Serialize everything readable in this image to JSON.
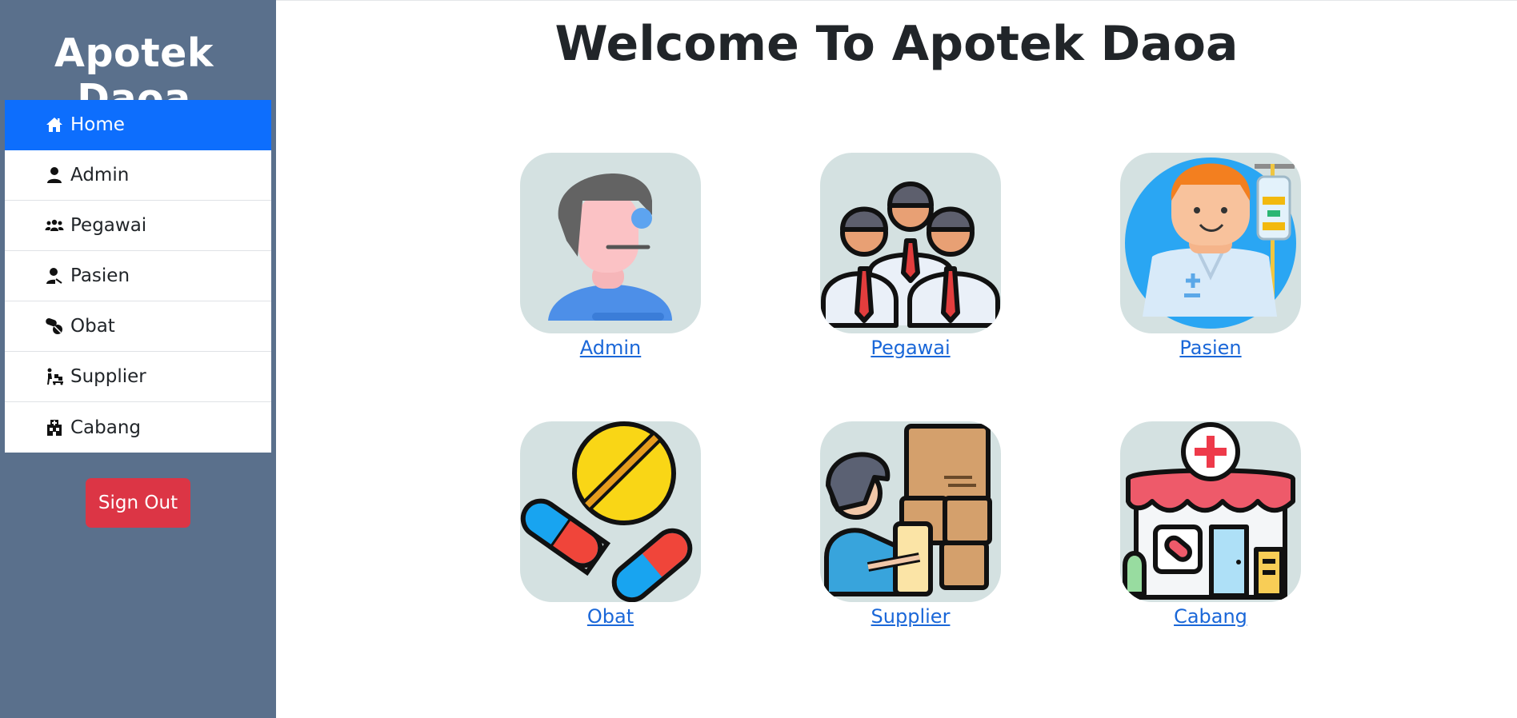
{
  "sidebar": {
    "brand": "Apotek Daoa",
    "items": [
      {
        "label": "Home",
        "icon": "home-icon",
        "active": true
      },
      {
        "label": "Admin",
        "icon": "user-icon",
        "active": false
      },
      {
        "label": "Pegawai",
        "icon": "users-icon",
        "active": false
      },
      {
        "label": "Pasien",
        "icon": "user-injured-icon",
        "active": false
      },
      {
        "label": "Obat",
        "icon": "pills-icon",
        "active": false
      },
      {
        "label": "Supplier",
        "icon": "dolly-icon",
        "active": false
      },
      {
        "label": "Cabang",
        "icon": "clinic-icon",
        "active": false
      }
    ],
    "signout_label": "Sign Out"
  },
  "main": {
    "title": "Welcome To Apotek Daoa",
    "cards": [
      {
        "label": "Admin",
        "icon": "admin-illustration"
      },
      {
        "label": "Pegawai",
        "icon": "employees-illustration"
      },
      {
        "label": "Pasien",
        "icon": "patient-illustration"
      },
      {
        "label": "Obat",
        "icon": "pills-illustration"
      },
      {
        "label": "Supplier",
        "icon": "supplier-illustration"
      },
      {
        "label": "Cabang",
        "icon": "pharmacy-store-illustration"
      }
    ]
  },
  "colors": {
    "sidebar_bg": "#5a708c",
    "active": "#0d6efd",
    "signout": "#dc3545",
    "tile_bg": "#d4e1e1",
    "link": "#1a67d8"
  }
}
